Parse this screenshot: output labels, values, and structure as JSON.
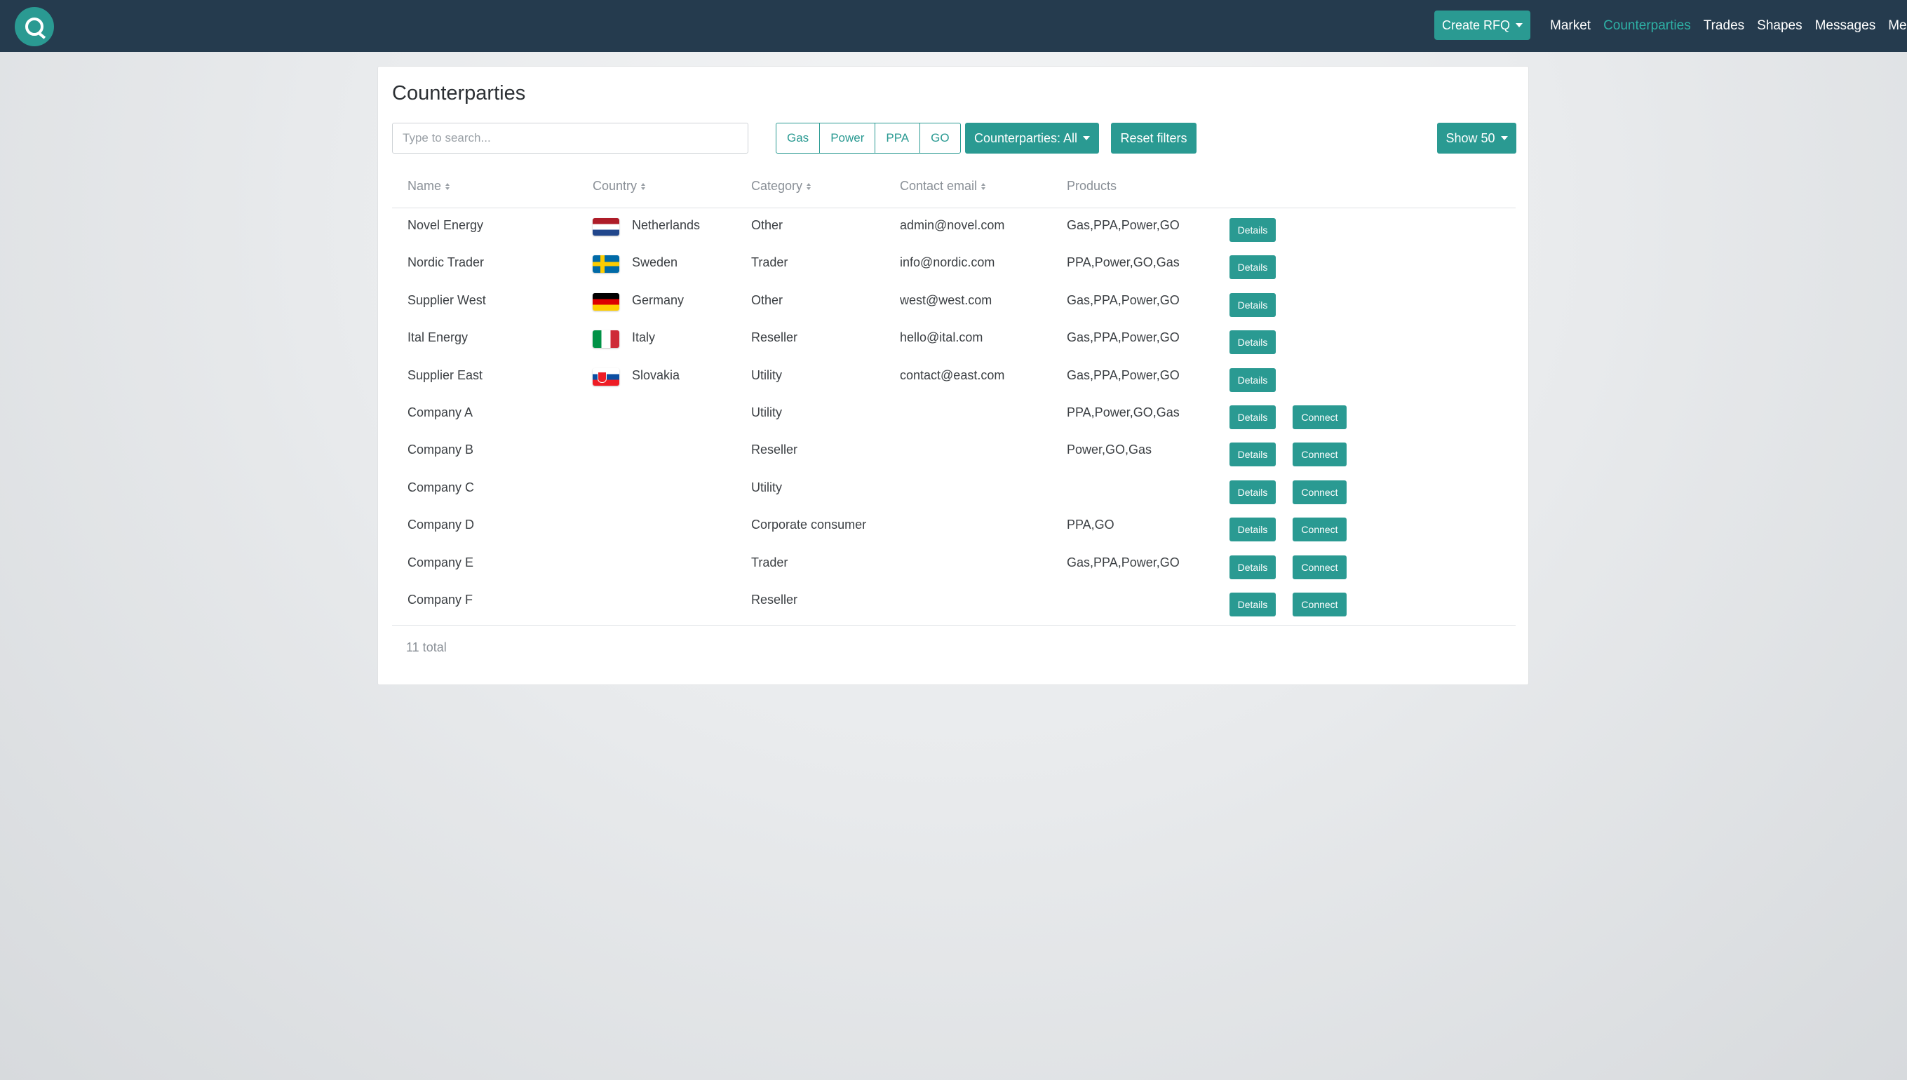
{
  "navbar": {
    "create_rfq": "Create RFQ",
    "links": [
      {
        "label": "Market",
        "active": false
      },
      {
        "label": "Counterparties",
        "active": true
      },
      {
        "label": "Trades",
        "active": false
      },
      {
        "label": "Shapes",
        "active": false
      },
      {
        "label": "Messages",
        "active": false
      },
      {
        "label": "Me",
        "active": false
      }
    ]
  },
  "page": {
    "title": "Counterparties",
    "search_placeholder": "Type to search...",
    "product_filters": [
      "Gas",
      "Power",
      "PPA",
      "GO"
    ],
    "counterparties_filter": "Counterparties: All",
    "reset_filters": "Reset filters",
    "show_count": "Show 50"
  },
  "table": {
    "headers": {
      "name": "Name",
      "country": "Country",
      "category": "Category",
      "email": "Contact email",
      "products": "Products"
    },
    "details_label": "Details",
    "connect_label": "Connect",
    "rows": [
      {
        "name": "Novel Energy",
        "country": "Netherlands",
        "flag": "nl",
        "category": "Other",
        "email": "admin@novel.com",
        "products": "Gas,PPA,Power,GO",
        "connect": false
      },
      {
        "name": "Nordic Trader",
        "country": "Sweden",
        "flag": "se",
        "category": "Trader",
        "email": "info@nordic.com",
        "products": "PPA,Power,GO,Gas",
        "connect": false
      },
      {
        "name": "Supplier West",
        "country": "Germany",
        "flag": "de",
        "category": "Other",
        "email": "west@west.com",
        "products": "Gas,PPA,Power,GO",
        "connect": false
      },
      {
        "name": "Ital Energy",
        "country": "Italy",
        "flag": "it",
        "category": "Reseller",
        "email": "hello@ital.com",
        "products": "Gas,PPA,Power,GO",
        "connect": false
      },
      {
        "name": "Supplier East",
        "country": "Slovakia",
        "flag": "sk",
        "category": "Utility",
        "email": "contact@east.com",
        "products": "Gas,PPA,Power,GO",
        "connect": false
      },
      {
        "name": "Company A",
        "country": "",
        "flag": "",
        "category": "Utility",
        "email": "",
        "products": "PPA,Power,GO,Gas",
        "connect": true
      },
      {
        "name": "Company B",
        "country": "",
        "flag": "",
        "category": "Reseller",
        "email": "",
        "products": "Power,GO,Gas",
        "connect": true
      },
      {
        "name": "Company C",
        "country": "",
        "flag": "",
        "category": "Utility",
        "email": "",
        "products": "",
        "connect": true
      },
      {
        "name": "Company D",
        "country": "",
        "flag": "",
        "category": "Corporate consumer",
        "email": "",
        "products": "PPA,GO",
        "connect": true
      },
      {
        "name": "Company E",
        "country": "",
        "flag": "",
        "category": "Trader",
        "email": "",
        "products": "Gas,PPA,Power,GO",
        "connect": true
      },
      {
        "name": "Company F",
        "country": "",
        "flag": "",
        "category": "Reseller",
        "email": "",
        "products": "",
        "connect": true
      }
    ],
    "total": "11 total"
  },
  "colors": {
    "navbar_bg": "#253b4e",
    "accent": "#2a9a92",
    "active_link": "#2eb2a6"
  }
}
